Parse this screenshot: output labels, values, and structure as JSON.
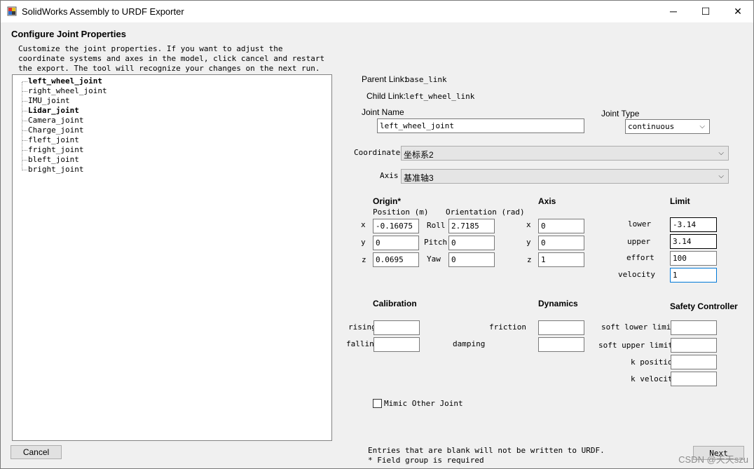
{
  "window": {
    "title": "SolidWorks Assembly to URDF Exporter",
    "minimize_glyph": "─",
    "maximize_glyph": "☐",
    "close_glyph": "✕"
  },
  "page": {
    "heading": "Configure Joint Properties",
    "description": "Customize the joint properties. If you want to adjust the coordinate systems and axes in the model, click cancel and restart the export. The tool will recognize your changes on the next run."
  },
  "tree": {
    "items": [
      {
        "label": "left_wheel_joint",
        "bold": true
      },
      {
        "label": "right_wheel_joint",
        "bold": false
      },
      {
        "label": "IMU_joint",
        "bold": false
      },
      {
        "label": "Lidar_joint",
        "bold": true
      },
      {
        "label": "Camera_joint",
        "bold": false
      },
      {
        "label": "Charge_joint",
        "bold": false
      },
      {
        "label": "fleft_joint",
        "bold": false
      },
      {
        "label": "fright_joint",
        "bold": false
      },
      {
        "label": "bleft_joint",
        "bold": false
      },
      {
        "label": "bright_joint",
        "bold": false
      }
    ]
  },
  "links": {
    "parent_label": "Parent Link:",
    "parent_value": "base_link",
    "child_label": "Child Link:",
    "child_value": "left_wheel_link"
  },
  "joint": {
    "name_label": "Joint Name",
    "name_value": "left_wheel_joint",
    "type_label": "Joint Type",
    "type_value": "continuous"
  },
  "coordinates": {
    "label": "Coordinates",
    "value": "坐标系2"
  },
  "axis_select": {
    "label": "Axis",
    "value": "基准轴3"
  },
  "origin": {
    "title": "Origin*",
    "position_label": "Position (m)",
    "orientation_label": "Orientation (rad)",
    "x_label": "x",
    "y_label": "y",
    "z_label": "z",
    "x": "-0.16075",
    "y": "0",
    "z": "0.0695",
    "roll_label": "Roll",
    "pitch_label": "Pitch",
    "yaw_label": "Yaw",
    "roll": "2.7185",
    "pitch": "0",
    "yaw": "0"
  },
  "axis": {
    "title": "Axis",
    "x_label": "x",
    "y_label": "y",
    "z_label": "z",
    "x": "0",
    "y": "0",
    "z": "1"
  },
  "limit": {
    "title": "Limit",
    "lower_label": "lower",
    "lower": "-3.14",
    "upper_label": "upper",
    "upper": "3.14",
    "effort_label": "effort",
    "effort": "100",
    "velocity_label": "velocity",
    "velocity": "1"
  },
  "calibration": {
    "title": "Calibration",
    "rising_label": "rising",
    "falling_label": "falling"
  },
  "dynamics": {
    "title": "Dynamics",
    "friction_label": "friction",
    "damping_label": "damping"
  },
  "safety": {
    "title": "Safety Controller",
    "soft_lower_label": "soft lower limit",
    "soft_upper_label": "soft upper limit",
    "k_position_label": "k position",
    "k_velocity_label": "k velocity"
  },
  "mimic": {
    "label": "Mimic Other Joint"
  },
  "footer": {
    "note1": "Entries that are blank will not be written to URDF.",
    "note2": "* Field group is required",
    "cancel_label": "Cancel",
    "next_label": "Next",
    "watermark": "CSDN @天天szu"
  }
}
